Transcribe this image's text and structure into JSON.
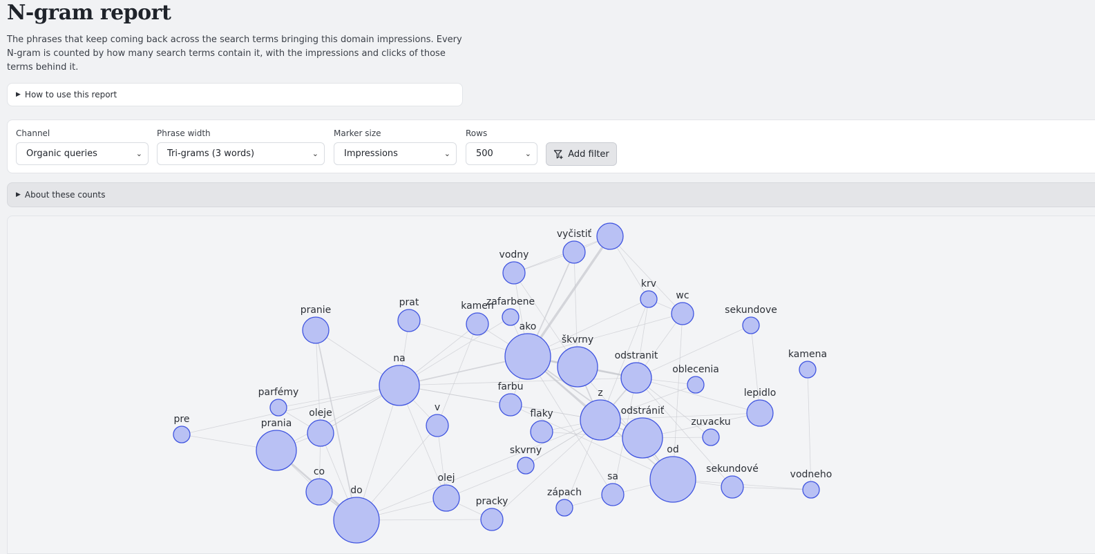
{
  "title": "N-gram report",
  "intro": "The phrases that keep coming back across the search terms bringing this domain impressions. Every N-gram is counted by how many search terms contain it, with the impressions and clicks of those terms behind it.",
  "how_to": "How to use this report",
  "controls": {
    "channel": {
      "label": "Channel",
      "value": "Organic queries"
    },
    "width": {
      "label": "Phrase width",
      "value": "Tri-grams (3 words)"
    },
    "marker": {
      "label": "Marker size",
      "value": "Impressions"
    },
    "rows": {
      "label": "Rows",
      "value": "500"
    },
    "add_filter": "Add filter"
  },
  "about": "About these counts",
  "colors": {
    "node_fill": "#b9c1f4",
    "node_stroke": "#3f54e0",
    "edge": "#c9cbd0"
  },
  "graph": {
    "nodes": [
      {
        "id": "vycistit",
        "label": "vyčistiť",
        "size": 2
      },
      {
        "id": "top",
        "label": "",
        "size": 3
      },
      {
        "id": "vodny",
        "label": "vodny",
        "size": 2
      },
      {
        "id": "krv",
        "label": "krv",
        "size": 1
      },
      {
        "id": "wc",
        "label": "wc",
        "size": 2
      },
      {
        "id": "sekundove",
        "label": "sekundove",
        "size": 1
      },
      {
        "id": "pranie",
        "label": "pranie",
        "size": 3
      },
      {
        "id": "prat",
        "label": "prat",
        "size": 2
      },
      {
        "id": "kamen",
        "label": "kamen",
        "size": 2
      },
      {
        "id": "zafarbene",
        "label": "zafarbene",
        "size": 1
      },
      {
        "id": "ako",
        "label": "ako",
        "size": 6
      },
      {
        "id": "skvrny",
        "label": "škvrny",
        "size": 5
      },
      {
        "id": "odstranit",
        "label": "odstranit",
        "size": 4
      },
      {
        "id": "kamena",
        "label": "kamena",
        "size": 1
      },
      {
        "id": "na",
        "label": "na",
        "size": 5
      },
      {
        "id": "oblecenia",
        "label": "oblecenia",
        "size": 1
      },
      {
        "id": "farbu",
        "label": "farbu",
        "size": 2
      },
      {
        "id": "lepidlo",
        "label": "lepidlo",
        "size": 3
      },
      {
        "id": "parfemy",
        "label": "parfémy",
        "size": 1
      },
      {
        "id": "z",
        "label": "z",
        "size": 5
      },
      {
        "id": "odstranit2",
        "label": "odstrániť",
        "size": 5
      },
      {
        "id": "pre",
        "label": "pre",
        "size": 1
      },
      {
        "id": "oleje",
        "label": "oleje",
        "size": 3
      },
      {
        "id": "v",
        "label": "v",
        "size": 2
      },
      {
        "id": "flaky",
        "label": "flaky",
        "size": 2
      },
      {
        "id": "zuvacku",
        "label": "zuvacku",
        "size": 1
      },
      {
        "id": "prania",
        "label": "prania",
        "size": 5
      },
      {
        "id": "skvrny2",
        "label": "skvrny",
        "size": 1
      },
      {
        "id": "od",
        "label": "od",
        "size": 6
      },
      {
        "id": "sekundove2",
        "label": "sekundové",
        "size": 2
      },
      {
        "id": "vodneho",
        "label": "vodneho",
        "size": 1
      },
      {
        "id": "co",
        "label": "co",
        "size": 3
      },
      {
        "id": "olej",
        "label": "olej",
        "size": 3
      },
      {
        "id": "sa",
        "label": "sa",
        "size": 2
      },
      {
        "id": "zapach",
        "label": "zápach",
        "size": 1
      },
      {
        "id": "do",
        "label": "do",
        "size": 6
      },
      {
        "id": "pracky",
        "label": "pracky",
        "size": 2
      }
    ],
    "edges": [
      [
        "ako",
        "top",
        4
      ],
      [
        "ako",
        "vycistit",
        2
      ],
      [
        "ako",
        "vodny",
        1
      ],
      [
        "ako",
        "skvrny",
        3
      ],
      [
        "ako",
        "odstranit",
        3
      ],
      [
        "ako",
        "odstranit2",
        2
      ],
      [
        "ako",
        "z",
        2
      ],
      [
        "ako",
        "od",
        2
      ],
      [
        "ako",
        "na",
        2
      ],
      [
        "ako",
        "kamen",
        1
      ],
      [
        "ako",
        "zafarbene",
        1
      ],
      [
        "ako",
        "prat",
        1
      ],
      [
        "ako",
        "farbu",
        1
      ],
      [
        "ako",
        "krv",
        1
      ],
      [
        "ako",
        "wc",
        1
      ],
      [
        "ako",
        "sa",
        1
      ],
      [
        "skvrny",
        "odstranit",
        2
      ],
      [
        "skvrny",
        "z",
        2
      ],
      [
        "skvrny",
        "od",
        1
      ],
      [
        "skvrny",
        "vycistit",
        1
      ],
      [
        "odstranit",
        "z",
        2
      ],
      [
        "odstranit",
        "oblecenia",
        1
      ],
      [
        "odstranit",
        "lepidlo",
        1
      ],
      [
        "odstranit",
        "krv",
        1
      ],
      [
        "odstranit",
        "wc",
        1
      ],
      [
        "odstranit",
        "sekundove",
        1
      ],
      [
        "odstranit",
        "zuvacku",
        1
      ],
      [
        "z",
        "odstranit2",
        2
      ],
      [
        "z",
        "oblecenia",
        1
      ],
      [
        "z",
        "farbu",
        1
      ],
      [
        "z",
        "flaky",
        1
      ],
      [
        "z",
        "skvrny2",
        1
      ],
      [
        "z",
        "lepidlo",
        1
      ],
      [
        "odstranit2",
        "od",
        2
      ],
      [
        "odstranit2",
        "lepidlo",
        1
      ],
      [
        "odstranit2",
        "zuvacku",
        1
      ],
      [
        "od",
        "sekundove2",
        1
      ],
      [
        "od",
        "vodneho",
        1
      ],
      [
        "sekundove2",
        "vodneho",
        1
      ],
      [
        "kamena",
        "vodneho",
        1
      ],
      [
        "sekundove",
        "lepidlo",
        1
      ],
      [
        "na",
        "pranie",
        1
      ],
      [
        "na",
        "prania",
        1
      ],
      [
        "na",
        "oleje",
        1
      ],
      [
        "na",
        "do",
        1
      ],
      [
        "na",
        "v",
        1
      ],
      [
        "na",
        "prat",
        1
      ],
      [
        "na",
        "kamen",
        1
      ],
      [
        "na",
        "zafarbene",
        1
      ],
      [
        "na",
        "farbu",
        1
      ],
      [
        "na",
        "parfemy",
        1
      ],
      [
        "na",
        "pre",
        1
      ],
      [
        "na",
        "olej",
        1
      ],
      [
        "pranie",
        "do",
        2
      ],
      [
        "prania",
        "do",
        3
      ],
      [
        "prania",
        "pre",
        1
      ],
      [
        "prania",
        "oleje",
        1
      ],
      [
        "prania",
        "co",
        1
      ],
      [
        "co",
        "do",
        2
      ],
      [
        "oleje",
        "co",
        1
      ],
      [
        "oleje",
        "do",
        1
      ],
      [
        "oleje",
        "na",
        1
      ],
      [
        "do",
        "olej",
        1
      ],
      [
        "do",
        "pracky",
        1
      ],
      [
        "do",
        "v",
        1
      ],
      [
        "olej",
        "skvrny2",
        1
      ],
      [
        "pracky",
        "olej",
        1
      ],
      [
        "vycistit",
        "top",
        1
      ],
      [
        "vodny",
        "vycistit",
        1
      ],
      [
        "vodny",
        "top",
        1
      ],
      [
        "krv",
        "top",
        1
      ],
      [
        "wc",
        "top",
        1
      ],
      [
        "zapach",
        "sa",
        1
      ],
      [
        "sa",
        "od",
        1
      ],
      [
        "skvrny2",
        "z",
        1
      ],
      [
        "flaky",
        "odstranit2",
        1
      ],
      [
        "pracky",
        "z",
        1
      ],
      [
        "zapach",
        "z",
        1
      ],
      [
        "v",
        "olej",
        1
      ],
      [
        "kamen",
        "v",
        1
      ],
      [
        "vodny",
        "skvrny",
        1
      ],
      [
        "wc",
        "krv",
        1
      ],
      [
        "wc",
        "od",
        1
      ],
      [
        "krv",
        "z",
        1
      ],
      [
        "parfemy",
        "oleje",
        1
      ],
      [
        "sekundove2",
        "odstranit",
        1
      ],
      [
        "farbu",
        "od",
        1
      ],
      [
        "odstranit",
        "na",
        1
      ],
      [
        "z",
        "na",
        1
      ],
      [
        "sa",
        "odstranit",
        1
      ],
      [
        "pranie",
        "oleje",
        1
      ],
      [
        "do",
        "z",
        1
      ]
    ]
  }
}
